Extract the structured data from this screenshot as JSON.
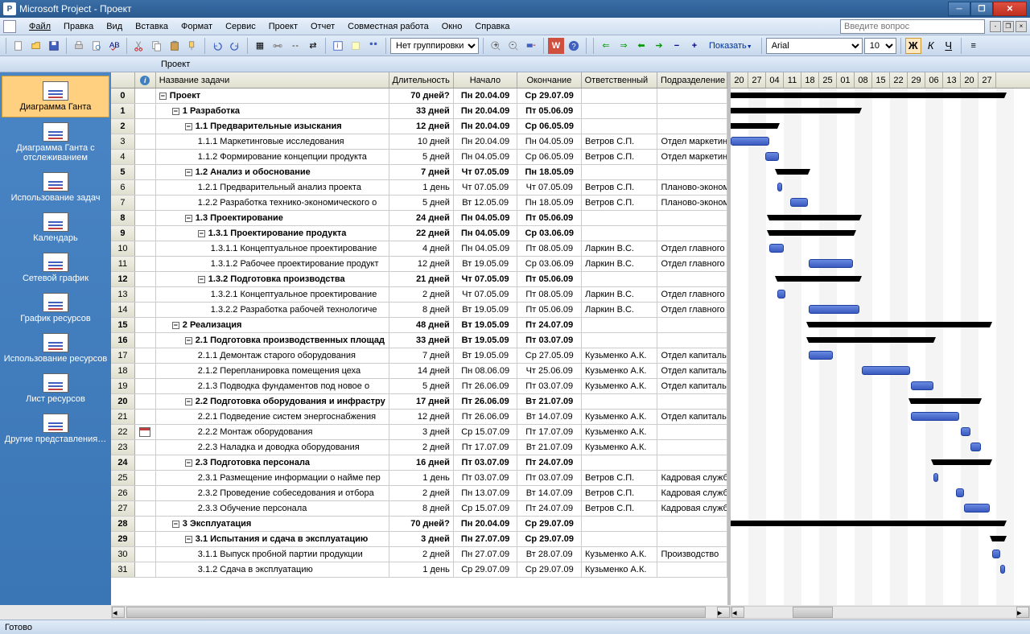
{
  "titlebar": {
    "text": "Microsoft Project - Проект"
  },
  "menu": {
    "file": "Файл",
    "edit": "Правка",
    "view": "Вид",
    "insert": "Вставка",
    "format": "Формат",
    "service": "Сервис",
    "project": "Проект",
    "report": "Отчет",
    "collab": "Совместная работа",
    "window": "Окно",
    "help": "Справка"
  },
  "question_placeholder": "Введите вопрос",
  "toolbar": {
    "group_select": "Нет группировки",
    "show_label": "Показать",
    "font_name": "Arial",
    "font_size": "10",
    "bold": "Ж",
    "italic": "К",
    "underline": "Ч"
  },
  "doc_label": "Проект",
  "sidebar": {
    "items": [
      {
        "label": "Диаграмма Ганта"
      },
      {
        "label": "Диаграмма Ганта с отслеживанием"
      },
      {
        "label": "Использование задач"
      },
      {
        "label": "Календарь"
      },
      {
        "label": "Сетевой график"
      },
      {
        "label": "График ресурсов"
      },
      {
        "label": "Использование ресурсов"
      },
      {
        "label": "Лист ресурсов"
      },
      {
        "label": "Другие представления…"
      }
    ]
  },
  "grid": {
    "headers": {
      "info": "ⓘ",
      "name": "Название задачи",
      "duration": "Длительность",
      "start": "Начало",
      "end": "Окончание",
      "resp": "Ответственный",
      "dept": "Подразделение"
    }
  },
  "timeline": [
    "20",
    "27",
    "04",
    "11",
    "18",
    "25",
    "01",
    "08",
    "15",
    "22",
    "29",
    "06",
    "13",
    "20",
    "27"
  ],
  "rows": [
    {
      "n": 0,
      "lvl": 0,
      "sum": true,
      "name": "Проект",
      "dur": "70 дней?",
      "start": "Пн 20.04.09",
      "end": "Ср 29.07.09",
      "resp": "",
      "dept": "",
      "gl": 0,
      "gw": 340
    },
    {
      "n": 1,
      "lvl": 1,
      "sum": true,
      "name": "1 Разработка",
      "dur": "33 дней",
      "start": "Пн 20.04.09",
      "end": "Пт 05.06.09",
      "resp": "",
      "dept": "",
      "gl": 0,
      "gw": 160
    },
    {
      "n": 2,
      "lvl": 2,
      "sum": true,
      "name": "1.1 Предварительные изыскания",
      "dur": "12 дней",
      "start": "Пн 20.04.09",
      "end": "Ср 06.05.09",
      "resp": "",
      "dept": "",
      "gl": 0,
      "gw": 58
    },
    {
      "n": 3,
      "lvl": 3,
      "sum": false,
      "name": "1.1.1 Маркетинговые исследования",
      "dur": "10 дней",
      "start": "Пн 20.04.09",
      "end": "Пн 04.05.09",
      "resp": "Ветров С.П.",
      "dept": "Отдел маркетин",
      "gl": 0,
      "gw": 48
    },
    {
      "n": 4,
      "lvl": 3,
      "sum": false,
      "name": "1.1.2 Формирование концепции продукта",
      "dur": "5 дней",
      "start": "Пн 04.05.09",
      "end": "Ср 06.05.09",
      "resp": "Ветров С.П.",
      "dept": "Отдел маркетин",
      "gl": 43,
      "gw": 17
    },
    {
      "n": 5,
      "lvl": 2,
      "sum": true,
      "name": "1.2 Анализ и обоснование",
      "dur": "7 дней",
      "start": "Чт 07.05.09",
      "end": "Пн 18.05.09",
      "resp": "",
      "dept": "",
      "gl": 58,
      "gw": 38
    },
    {
      "n": 6,
      "lvl": 3,
      "sum": false,
      "name": "1.2.1 Предварительный анализ проекта",
      "dur": "1 день",
      "start": "Чт 07.05.09",
      "end": "Чт 07.05.09",
      "resp": "Ветров С.П.",
      "dept": "Планово-эконом",
      "gl": 58,
      "gw": 6
    },
    {
      "n": 7,
      "lvl": 3,
      "sum": false,
      "name": "1.2.2 Разработка технико-экономического о",
      "dur": "5 дней",
      "start": "Вт 12.05.09",
      "end": "Пн 18.05.09",
      "resp": "Ветров С.П.",
      "dept": "Планово-эконом",
      "gl": 74,
      "gw": 22
    },
    {
      "n": 8,
      "lvl": 2,
      "sum": true,
      "name": "1.3 Проектирование",
      "dur": "24 дней",
      "start": "Пн 04.05.09",
      "end": "Пт 05.06.09",
      "resp": "",
      "dept": "",
      "gl": 48,
      "gw": 112
    },
    {
      "n": 9,
      "lvl": 3,
      "sum": true,
      "name": "1.3.1 Проектирование продукта",
      "dur": "22 дней",
      "start": "Пн 04.05.09",
      "end": "Ср 03.06.09",
      "resp": "",
      "dept": "",
      "gl": 48,
      "gw": 105
    },
    {
      "n": 10,
      "lvl": 4,
      "sum": false,
      "name": "1.3.1.1 Концептуальное проектирование",
      "dur": "4 дней",
      "start": "Пн 04.05.09",
      "end": "Пт 08.05.09",
      "resp": "Ларкин В.С.",
      "dept": "Отдел главного",
      "gl": 48,
      "gw": 18
    },
    {
      "n": 11,
      "lvl": 4,
      "sum": false,
      "name": "1.3.1.2 Рабочее проектирование продукт",
      "dur": "12 дней",
      "start": "Вт 19.05.09",
      "end": "Ср 03.06.09",
      "resp": "Ларкин В.С.",
      "dept": "Отдел главного",
      "gl": 97,
      "gw": 55
    },
    {
      "n": 12,
      "lvl": 3,
      "sum": true,
      "name": "1.3.2 Подготовка производства",
      "dur": "21 дней",
      "start": "Чт 07.05.09",
      "end": "Пт 05.06.09",
      "resp": "",
      "dept": "",
      "gl": 58,
      "gw": 102
    },
    {
      "n": 13,
      "lvl": 4,
      "sum": false,
      "name": "1.3.2.1 Концептуальное проектирование",
      "dur": "2 дней",
      "start": "Чт 07.05.09",
      "end": "Пт 08.05.09",
      "resp": "Ларкин В.С.",
      "dept": "Отдел главного",
      "gl": 58,
      "gw": 10
    },
    {
      "n": 14,
      "lvl": 4,
      "sum": false,
      "name": "1.3.2.2 Разработка рабочей технологиче",
      "dur": "8 дней",
      "start": "Вт 19.05.09",
      "end": "Пт 05.06.09",
      "resp": "Ларкин В.С.",
      "dept": "Отдел главного",
      "gl": 97,
      "gw": 63
    },
    {
      "n": 15,
      "lvl": 1,
      "sum": true,
      "name": "2 Реализация",
      "dur": "48 дней",
      "start": "Вт 19.05.09",
      "end": "Пт 24.07.09",
      "resp": "",
      "dept": "",
      "gl": 97,
      "gw": 225
    },
    {
      "n": 16,
      "lvl": 2,
      "sum": true,
      "name": "2.1 Подготовка производственных площад",
      "dur": "33 дней",
      "start": "Вт 19.05.09",
      "end": "Пт 03.07.09",
      "resp": "",
      "dept": "",
      "gl": 97,
      "gw": 155
    },
    {
      "n": 17,
      "lvl": 3,
      "sum": false,
      "name": "2.1.1 Демонтаж старого оборудования",
      "dur": "7 дней",
      "start": "Вт 19.05.09",
      "end": "Ср 27.05.09",
      "resp": "Кузьменко А.К.",
      "dept": "Отдел капитальн",
      "gl": 97,
      "gw": 30
    },
    {
      "n": 18,
      "lvl": 3,
      "sum": false,
      "name": "2.1.2 Перепланировка помещения цеха",
      "dur": "14 дней",
      "start": "Пн 08.06.09",
      "end": "Чт 25.06.09",
      "resp": "Кузьменко А.К.",
      "dept": "Отдел капитальн",
      "gl": 163,
      "gw": 60
    },
    {
      "n": 19,
      "lvl": 3,
      "sum": false,
      "name": "2.1.3 Подводка фундаментов под новое о",
      "dur": "5 дней",
      "start": "Пт 26.06.09",
      "end": "Пт 03.07.09",
      "resp": "Кузьменко А.К.",
      "dept": "Отдел капитальн",
      "gl": 224,
      "gw": 28
    },
    {
      "n": 20,
      "lvl": 2,
      "sum": true,
      "name": "2.2 Подготовка оборудования и инфрастру",
      "dur": "17 дней",
      "start": "Пт 26.06.09",
      "end": "Вт 21.07.09",
      "resp": "",
      "dept": "",
      "gl": 224,
      "gw": 85
    },
    {
      "n": 21,
      "lvl": 3,
      "sum": false,
      "name": "2.2.1 Подведение систем энергоснабжения",
      "dur": "12 дней",
      "start": "Пт 26.06.09",
      "end": "Вт 14.07.09",
      "resp": "Кузьменко А.К.",
      "dept": "Отдел капитальн",
      "gl": 224,
      "gw": 60
    },
    {
      "n": 22,
      "lvl": 3,
      "sum": false,
      "name": "2.2.2 Монтаж оборудования",
      "dur": "3 дней",
      "start": "Ср 15.07.09",
      "end": "Пт 17.07.09",
      "resp": "Кузьменко А.К.",
      "dept": "",
      "gl": 286,
      "gw": 12,
      "info": "cal"
    },
    {
      "n": 23,
      "lvl": 3,
      "sum": false,
      "name": "2.2.3 Наладка и доводка оборудования",
      "dur": "2 дней",
      "start": "Пт 17.07.09",
      "end": "Вт 21.07.09",
      "resp": "Кузьменко А.К.",
      "dept": "",
      "gl": 298,
      "gw": 13
    },
    {
      "n": 24,
      "lvl": 2,
      "sum": true,
      "name": "2.3 Подготовка персонала",
      "dur": "16 дней",
      "start": "Пт 03.07.09",
      "end": "Пт 24.07.09",
      "resp": "",
      "dept": "",
      "gl": 252,
      "gw": 70
    },
    {
      "n": 25,
      "lvl": 3,
      "sum": false,
      "name": "2.3.1 Размещение информации о найме пер",
      "dur": "1 день",
      "start": "Пт 03.07.09",
      "end": "Пт 03.07.09",
      "resp": "Ветров С.П.",
      "dept": "Кадровая служб",
      "gl": 252,
      "gw": 6
    },
    {
      "n": 26,
      "lvl": 3,
      "sum": false,
      "name": "2.3.2 Проведение собеседования и отбора",
      "dur": "2 дней",
      "start": "Пн 13.07.09",
      "end": "Вт 14.07.09",
      "resp": "Ветров С.П.",
      "dept": "Кадровая служб",
      "gl": 280,
      "gw": 10
    },
    {
      "n": 27,
      "lvl": 3,
      "sum": false,
      "name": "2.3.3 Обучение персонала",
      "dur": "8 дней",
      "start": "Ср 15.07.09",
      "end": "Пт 24.07.09",
      "resp": "Ветров С.П.",
      "dept": "Кадровая служб",
      "gl": 290,
      "gw": 32
    },
    {
      "n": 28,
      "lvl": 1,
      "sum": true,
      "name": "3 Эксплуатация",
      "dur": "70 дней?",
      "start": "Пн 20.04.09",
      "end": "Ср 29.07.09",
      "resp": "",
      "dept": "",
      "gl": 0,
      "gw": 340
    },
    {
      "n": 29,
      "lvl": 2,
      "sum": true,
      "name": "3.1 Испытания и сдача в эксплуатацию",
      "dur": "3 дней",
      "start": "Пн 27.07.09",
      "end": "Ср 29.07.09",
      "resp": "",
      "dept": "",
      "gl": 325,
      "gw": 15
    },
    {
      "n": 30,
      "lvl": 3,
      "sum": false,
      "name": "3.1.1 Выпуск пробной партии продукции",
      "dur": "2 дней",
      "start": "Пн 27.07.09",
      "end": "Вт 28.07.09",
      "resp": "Кузьменко А.К.",
      "dept": "Производство",
      "gl": 325,
      "gw": 10
    },
    {
      "n": 31,
      "lvl": 3,
      "sum": false,
      "name": "3.1.2 Сдача в эксплуатацию",
      "dur": "1 день",
      "start": "Ср 29.07.09",
      "end": "Ср 29.07.09",
      "resp": "Кузьменко А.К.",
      "dept": "",
      "gl": 335,
      "gw": 6
    }
  ],
  "status": "Готово"
}
